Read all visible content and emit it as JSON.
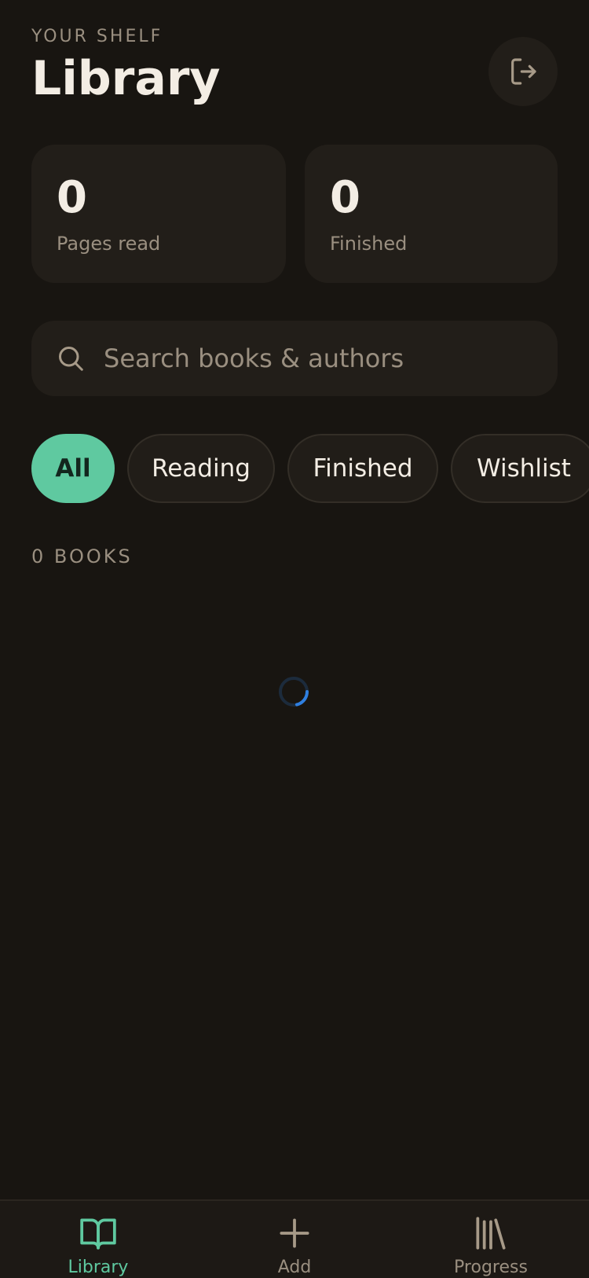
{
  "header": {
    "eyebrow": "YOUR SHELF",
    "title": "Library"
  },
  "stats": [
    {
      "value": "0",
      "label": "Pages read"
    },
    {
      "value": "0",
      "label": "Finished"
    }
  ],
  "search": {
    "placeholder": "Search books & authors",
    "value": ""
  },
  "filters": [
    {
      "label": "All",
      "active": true
    },
    {
      "label": "Reading",
      "active": false
    },
    {
      "label": "Finished",
      "active": false
    },
    {
      "label": "Wishlist",
      "active": false
    }
  ],
  "list": {
    "count_label": "0 BOOKS"
  },
  "nav": [
    {
      "label": "Library",
      "icon": "open-book-icon",
      "active": true
    },
    {
      "label": "Add",
      "icon": "plus-icon",
      "active": false
    },
    {
      "label": "Progress",
      "icon": "bookshelf-icon",
      "active": false
    }
  ],
  "colors": {
    "background": "#181511",
    "card": "#221e19",
    "accent": "#5fc9a0",
    "muted_text": "#9a8f80",
    "text": "#f3ede4",
    "spinner": "#2f7fe0"
  }
}
